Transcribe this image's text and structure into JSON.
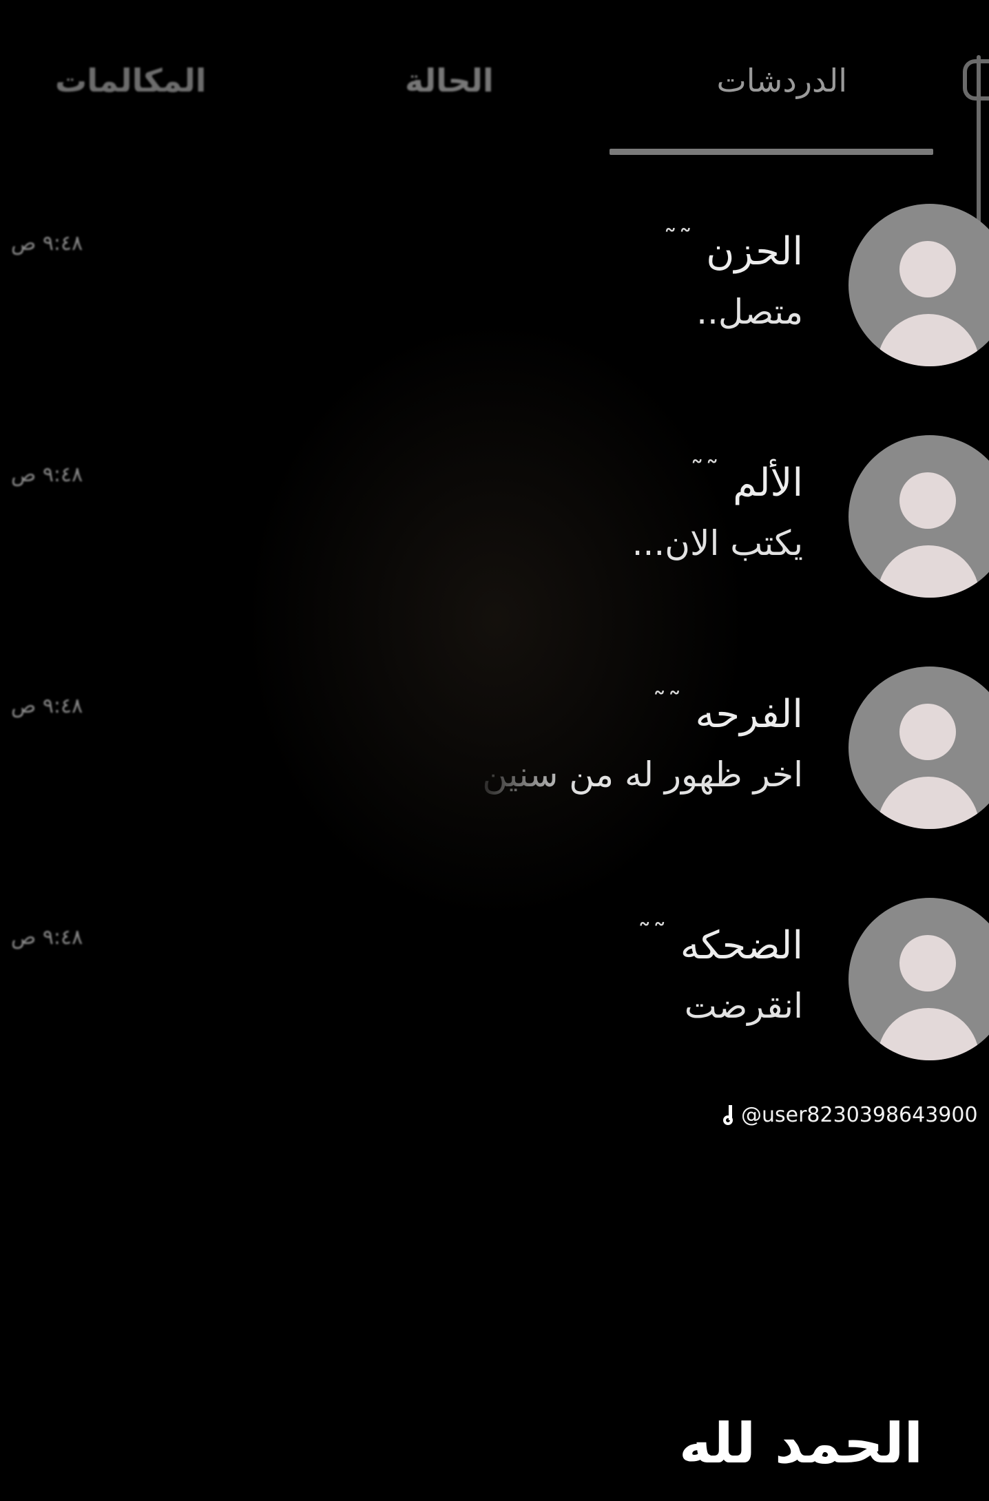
{
  "tabs": {
    "chats": "الدردشات",
    "status": "الحالة",
    "calls": "المكالمات",
    "active": "chats"
  },
  "chats": [
    {
      "name": "الحزن",
      "mark": "˜˜",
      "subtitle": "متصل..",
      "time": "٩:٤٨ ص",
      "icon": "default-avatar-icon"
    },
    {
      "name": "الألم",
      "mark": "˜˜",
      "subtitle": "يكتب الان...",
      "time": "٩:٤٨ ص",
      "icon": "default-avatar-icon"
    },
    {
      "name": "الفرحه",
      "mark": "˜˜",
      "subtitle": "اخر ظهور له من سنين",
      "time": "٩:٤٨ ص",
      "icon": "default-avatar-icon"
    },
    {
      "name": "الضحكه",
      "mark": "˜˜",
      "subtitle": "انقرضت",
      "time": "٩:٤٨ ص",
      "icon": "default-avatar-icon"
    }
  ],
  "watermark": "@user8230398643900",
  "caption": "الحمد لله",
  "colors": {
    "background": "#000000",
    "text": "#e6e6e6",
    "avatar_bg": "#8a8a8a",
    "avatar_fg": "#e3d9d9",
    "indicator": "#7a7a7a"
  }
}
